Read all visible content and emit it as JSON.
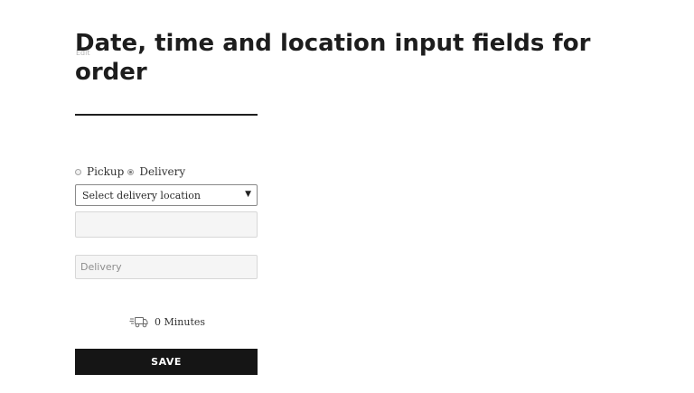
{
  "page": {
    "edit_link": "Edit",
    "title": "Date, time and location input fields for order"
  },
  "order_form": {
    "order_type": {
      "options": [
        "Pickup",
        "Delivery"
      ],
      "selected": "Delivery"
    },
    "location_select": {
      "selected_value": "Select delivery location"
    },
    "delivery_input": {
      "value": "",
      "placeholder": "Delivery"
    },
    "eta": {
      "icon": "delivery-truck-icon",
      "text": "0 Minutes"
    },
    "save_label": "SAVE"
  },
  "colors": {
    "button_bg": "#151515",
    "button_text": "#ffffff",
    "title": "#1d1d1d",
    "field_bg": "#f5f5f5"
  }
}
